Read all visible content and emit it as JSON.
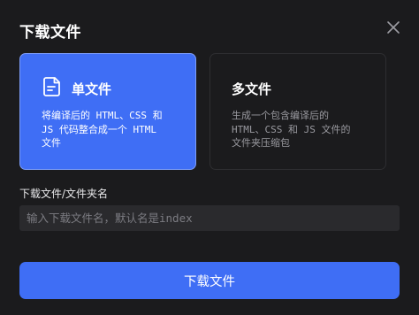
{
  "dialog": {
    "title": "下载文件",
    "close_icon": "close-icon"
  },
  "options": {
    "single": {
      "title": "单文件",
      "icon": "file-icon",
      "description": "将编译后的 HTML、CSS 和\nJS 代码整合成一个 HTML\n文件",
      "selected": true
    },
    "multi": {
      "title": "多文件",
      "description": "生成一个包含编译后的\nHTML、CSS 和 JS 文件的\n文件夹压缩包",
      "selected": false
    }
  },
  "field": {
    "label": "下载文件/文件夹名",
    "value": "",
    "placeholder": "输入下载文件名，默认名是index"
  },
  "actions": {
    "download_label": "下载文件"
  },
  "colors": {
    "accent": "#3f6ef5",
    "background": "#1b1b1d",
    "input_bg": "#2a2a2d"
  }
}
